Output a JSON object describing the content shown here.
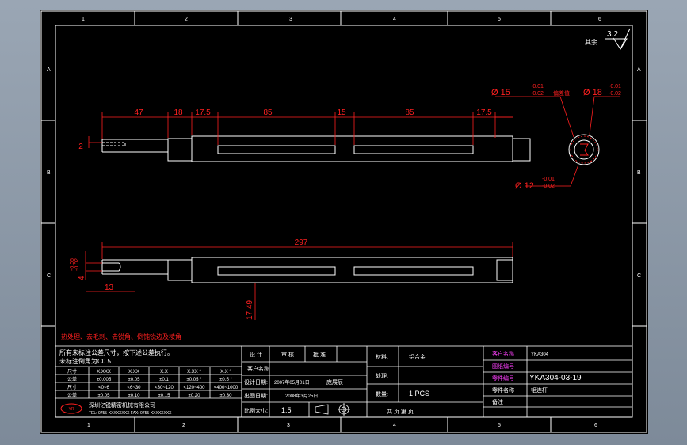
{
  "colors": {
    "background": "#000000",
    "line": "#ffffff",
    "dimension": "#ff2020",
    "annotation": "#ff40ff",
    "sheet_bg": "#8b96a4"
  },
  "border": {
    "top_zones": [
      "1",
      "2",
      "3",
      "4",
      "5",
      "6"
    ],
    "bottom_zones": [
      "1",
      "2",
      "3",
      "4",
      "5",
      "6"
    ],
    "left_zones": [
      "A",
      "B",
      "C"
    ],
    "right_zones": [
      "A",
      "B",
      "C"
    ]
  },
  "roughness": {
    "label": "其余",
    "value": "3.2"
  },
  "view_top": {
    "dims": [
      "47",
      "18",
      "17.5",
      "85",
      "15",
      "85",
      "17.5"
    ],
    "left_dim": "2"
  },
  "view_front": {
    "overall": "297",
    "dim_13": "13",
    "dim_17_49": "17.49",
    "dim_4": "4",
    "tol_upper": "-0.02",
    "tol_lower": "-0.06"
  },
  "section": {
    "d15": {
      "value": "Ø 15",
      "upper": "-0.01",
      "lower": "-0.02",
      "note": "偏差值"
    },
    "d18": {
      "value": "Ø 18",
      "upper": "-0.01",
      "lower": "-0.02"
    },
    "d12": {
      "value": "Ø 12",
      "upper": "-0.01",
      "lower": "-0.02"
    }
  },
  "tech_note": "热处理、去毛刺、去锐角、倒钝锐边及棱角",
  "general_tol": {
    "title1": "所有未标注公差尺寸，按下述公差执行。",
    "title2": "未标注倒角为C0.5",
    "headers": [
      "尺寸",
      "X.XXX",
      "X.XX",
      "X.X",
      "X.XX °",
      "X.X °"
    ],
    "row1": [
      "公差",
      "±0.005",
      "±0.05",
      "±0.1",
      "±0.05 °",
      "±0.5 °"
    ],
    "row2": [
      "尺寸",
      "<0~6",
      "<6~30",
      "<30~120",
      "<120~400",
      "<400~1000"
    ],
    "row3": [
      "公差",
      "±0.05",
      "±0.10",
      "±0.15",
      "±0.20",
      "±0.30"
    ]
  },
  "company": {
    "line1": "深圳亿锐精密机械有限公司",
    "line2": "TEL: 0755-XXXXXXXX   FAX: 0755-XXXXXXXX"
  },
  "title_block": {
    "row1": [
      "设 计",
      "审 核",
      "批 准"
    ],
    "label_customer": "客户名称",
    "design_date_label": "设计日期:",
    "design_date_value": "2007年05月01日",
    "drawn_by": "庞展辰",
    "issue_date_label": "出图日期:",
    "issue_date_value": "2008年3月25日",
    "scale_label": "比例大小:",
    "scale_value": "1:5",
    "material_label": "材料:",
    "material_value": "铝合金",
    "treatment_label": "处理:",
    "qty_label": "数量:",
    "qty_value": "1 PCS",
    "sheet_label": "共 页   第 页",
    "customer_name_label": "客户名称",
    "customer_name_value": "YKA304",
    "drawing_no_label": "图纸编号",
    "part_no_label": "零件编号",
    "part_no_value": "YKA304-03-19",
    "part_name_label": "零件名称",
    "part_name_value": "铝连杆",
    "remark_label": "备注"
  }
}
